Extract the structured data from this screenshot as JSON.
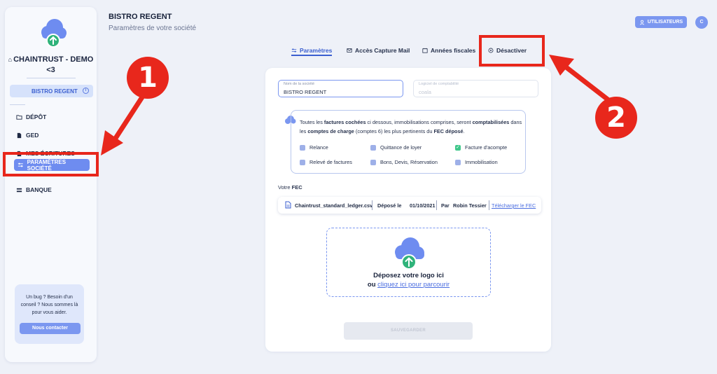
{
  "sidebar": {
    "org_name": "CHAINTRUST - DEMO",
    "org_name_suffix": "<3",
    "company": "BISTRO REGENT",
    "items": [
      {
        "label": "DÉPÔT",
        "icon": "folder-upload-icon"
      },
      {
        "label": "GED",
        "icon": "document-icon"
      },
      {
        "label": "MES ÉCRITURES",
        "icon": "ledger-icon"
      },
      {
        "label": "PARAMÈTRES SOCIÉTÉ",
        "icon": "sliders-icon",
        "active": true
      },
      {
        "label": "BANQUE",
        "icon": "bank-icon"
      }
    ],
    "help_text": "Un bug ? Besoin d'un conseil ? Nous sommes là pour vous aider.",
    "help_button": "Nous contacter"
  },
  "header": {
    "title": "BISTRO REGENT",
    "subtitle": "Paramètres de votre société",
    "users_button": "UTILISATEURS",
    "avatar_initial": "C"
  },
  "tabs": [
    {
      "label": "Paramètres",
      "icon": "sliders-icon",
      "active": true
    },
    {
      "label": "Accès Capture Mail",
      "icon": "mail-icon"
    },
    {
      "label": "Années fiscales",
      "icon": "calendar-icon"
    },
    {
      "label": "Désactiver",
      "icon": "power-icon"
    }
  ],
  "form": {
    "company_name_label": "Nom de la société",
    "company_name_value": "BISTRO REGENT",
    "software_label": "Logiciel de comptabilité",
    "software_value": "coala"
  },
  "info": {
    "t1": "Toutes les ",
    "b1": "factures cochées",
    "t2": " ci dessous, immobilisations comprises, seront ",
    "b2": "comptabilisées",
    "t3": " dans les ",
    "b3": "comptes de charge",
    "t4": " (comptes 6) les plus pertinents du ",
    "b4": "FEC déposé",
    "t5": "."
  },
  "checkboxes": [
    {
      "label": "Relance",
      "checked": false
    },
    {
      "label": "Quittance de loyer",
      "checked": false
    },
    {
      "label": "Facture d'acompte",
      "checked": true
    },
    {
      "label": "Relevé de factures",
      "checked": false
    },
    {
      "label": "Bons, Devis, Réservation",
      "checked": false
    },
    {
      "label": "Immobilisation",
      "checked": false
    }
  ],
  "fec": {
    "label_prefix": "Votre ",
    "label_bold": "FEC",
    "filename": "Chaintrust_standard_ledger.csv",
    "deposited_label": "Déposé le",
    "deposited_date": "01/10/2021",
    "by_label": "Par",
    "by_name": "Robin Tessier",
    "download_link": "Télécharger le FEC"
  },
  "dropzone": {
    "title": "Déposez votre logo ici",
    "or_text": "ou ",
    "browse_link": "cliquez ici pour parcourir"
  },
  "save_button": "SAUVEGARDER",
  "annotations": {
    "badge1": "1",
    "badge2": "2"
  },
  "colors": {
    "accent": "#7b97f0",
    "accent_dark": "#3b5fd0",
    "annotation_red": "#e8271c",
    "checked_green": "#3fc78a",
    "upload_green": "#2fb37a"
  }
}
